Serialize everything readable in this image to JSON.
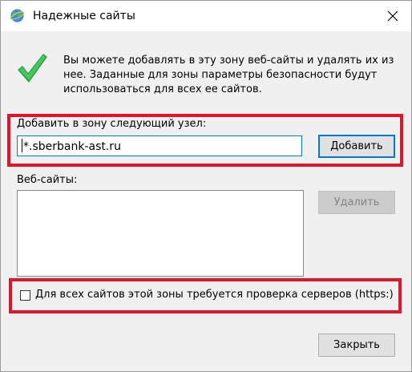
{
  "window": {
    "title": "Надежные сайты",
    "close_glyph": "✕"
  },
  "info": {
    "text": "Вы можете добавлять в эту зону  веб-сайты и удалять их из нее. Заданные для зоны параметры безопасности будут использоваться для всех ее сайтов."
  },
  "add_zone": {
    "label": "Добавить в зону следующий узел:",
    "input_value": "*.sberbank-ast.ru",
    "add_button": "Добавить"
  },
  "websites": {
    "label": "Веб-сайты:",
    "items": [],
    "remove_button": "Удалить"
  },
  "https_check": {
    "label": "Для всех сайтов этой зоны требуется проверка серверов (https:)",
    "checked": false
  },
  "footer": {
    "close_button": "Закрыть"
  },
  "colors": {
    "highlight": "#e0142a",
    "focus_border": "#0078d7",
    "check_green": "#22a63c"
  },
  "icons": {
    "title": "globe-icon",
    "info": "checkmark-icon"
  }
}
